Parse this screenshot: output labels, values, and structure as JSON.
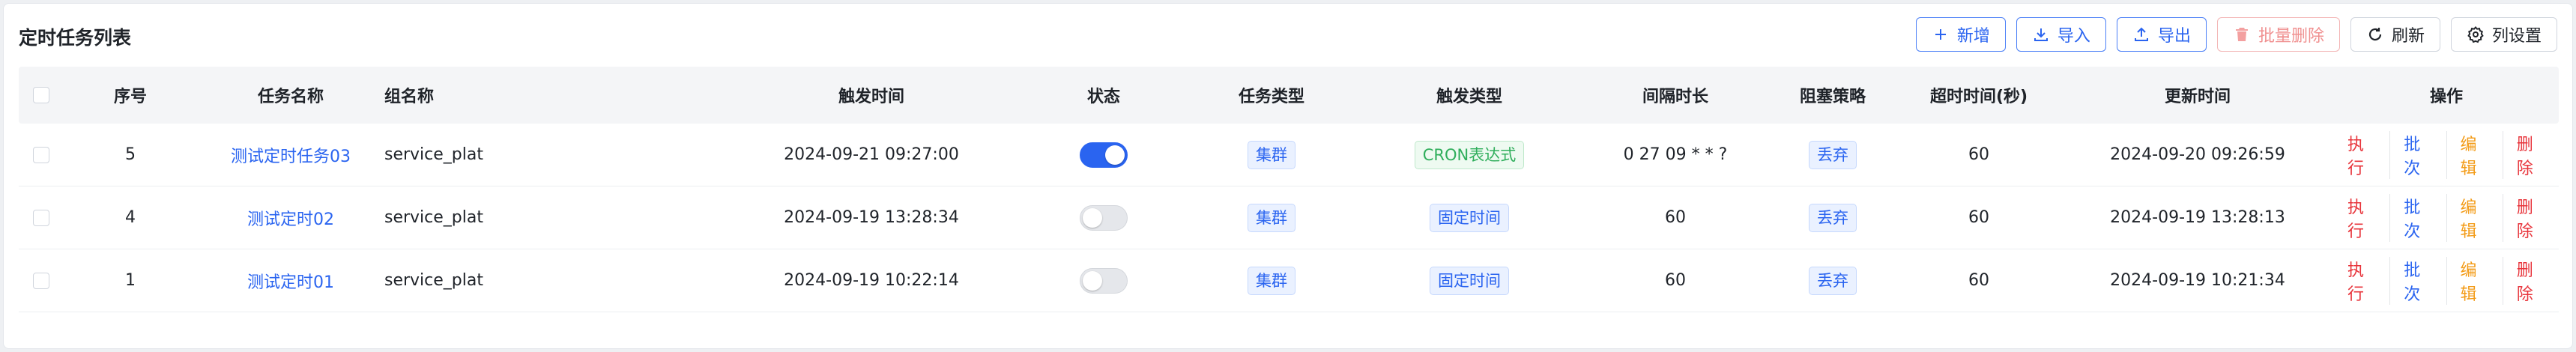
{
  "title": "定时任务列表",
  "toolbar": {
    "add": "新增",
    "import": "导入",
    "export": "导出",
    "batch_delete": "批量删除",
    "refresh": "刷新",
    "column_settings": "列设置"
  },
  "columns": {
    "seq": "序号",
    "name": "任务名称",
    "group": "组名称",
    "trigger_time": "触发时间",
    "status": "状态",
    "task_type": "任务类型",
    "trigger_type": "触发类型",
    "interval": "间隔时长",
    "block_strategy": "阻塞策略",
    "timeout": "超时时间(秒)",
    "updated": "更新时间",
    "actions": "操作"
  },
  "rows": [
    {
      "seq": "5",
      "name": "测试定时任务03",
      "group": "service_plat",
      "trigger_time": "2024-09-21 09:27:00",
      "status_on": true,
      "task_type": "集群",
      "trigger_type": "CRON表达式",
      "interval": "0 27 09 * * ?",
      "block_strategy": "丢弃",
      "timeout": "60",
      "updated": "2024-09-20 09:26:59"
    },
    {
      "seq": "4",
      "name": "测试定时02",
      "group": "service_plat",
      "trigger_time": "2024-09-19 13:28:34",
      "status_on": false,
      "task_type": "集群",
      "trigger_type": "固定时间",
      "interval": "60",
      "block_strategy": "丢弃",
      "timeout": "60",
      "updated": "2024-09-19 13:28:13"
    },
    {
      "seq": "1",
      "name": "测试定时01",
      "group": "service_plat",
      "trigger_time": "2024-09-19 10:22:14",
      "status_on": false,
      "task_type": "集群",
      "trigger_type": "固定时间",
      "interval": "60",
      "block_strategy": "丢弃",
      "timeout": "60",
      "updated": "2024-09-19 10:21:34"
    }
  ],
  "row_actions": {
    "execute": "执行",
    "batch": "批次",
    "edit": "编辑",
    "delete": "删除"
  },
  "colors": {
    "primary": "#2a64f0",
    "danger": "#e8343b",
    "warning": "#f39b17",
    "success": "#2fae5b"
  },
  "icons": {
    "add": "plus-icon",
    "import": "download-icon",
    "export": "upload-icon",
    "batch_delete": "trash-icon",
    "refresh": "refresh-icon",
    "column_settings": "gear-icon"
  }
}
